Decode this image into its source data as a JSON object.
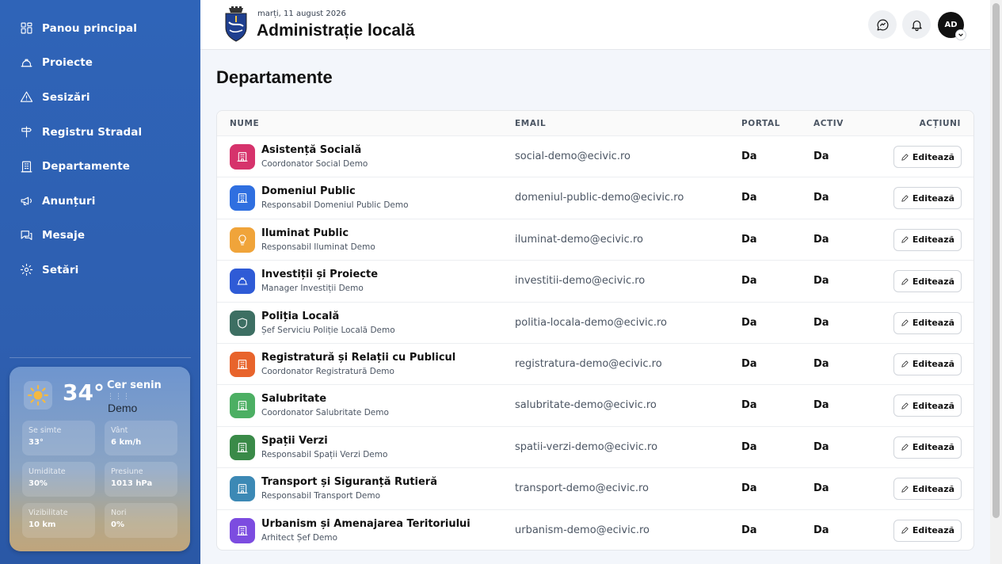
{
  "sidebar": {
    "items": [
      {
        "label": "Panou principal",
        "icon": "dashboard-icon"
      },
      {
        "label": "Proiecte",
        "icon": "helmet-icon"
      },
      {
        "label": "Sesizări",
        "icon": "warning-icon"
      },
      {
        "label": "Registru Stradal",
        "icon": "signpost-icon"
      },
      {
        "label": "Departamente",
        "icon": "building-icon"
      },
      {
        "label": "Anunțuri",
        "icon": "megaphone-icon"
      },
      {
        "label": "Mesaje",
        "icon": "chat-icon"
      },
      {
        "label": "Setări",
        "icon": "gear-icon"
      }
    ]
  },
  "weather": {
    "temp": "34°",
    "condition": "Cer senin",
    "dots": "⋮⋮⋮",
    "location": "Demo",
    "details": [
      {
        "label": "Se simte",
        "value": "33°"
      },
      {
        "label": "Vânt",
        "value": "6 km/h"
      },
      {
        "label": "Umiditate",
        "value": "30%"
      },
      {
        "label": "Presiune",
        "value": "1013 hPa"
      },
      {
        "label": "Vizibilitate",
        "value": "10 km"
      },
      {
        "label": "Nori",
        "value": "0%"
      }
    ]
  },
  "header": {
    "date": "marți, 11 august 2026",
    "title": "Administrație locală",
    "avatar_initials": "AD"
  },
  "page": {
    "title": "Departamente"
  },
  "table": {
    "columns": {
      "name": "NUME",
      "email": "EMAIL",
      "portal": "PORTAL",
      "active": "ACTIV",
      "actions": "ACȚIUNI"
    },
    "edit_label": "Editează",
    "rows": [
      {
        "name": "Asistență Socială",
        "sub": "Coordonator Social Demo",
        "email": "social-demo@ecivic.ro",
        "portal": "Da",
        "active": "Da",
        "color": "#d6336c",
        "icon": "building-icon"
      },
      {
        "name": "Domeniul Public",
        "sub": "Responsabil Domeniul Public Demo",
        "email": "domeniul-public-demo@ecivic.ro",
        "portal": "Da",
        "active": "Da",
        "color": "#2f6fe0",
        "icon": "building-icon"
      },
      {
        "name": "Iluminat Public",
        "sub": "Responsabil Iluminat Demo",
        "email": "iluminat-demo@ecivic.ro",
        "portal": "Da",
        "active": "Da",
        "color": "#f0a43a",
        "icon": "lightbulb-icon"
      },
      {
        "name": "Investiții și Proiecte",
        "sub": "Manager Investiții Demo",
        "email": "investitii-demo@ecivic.ro",
        "portal": "Da",
        "active": "Da",
        "color": "#2f5bd6",
        "icon": "helmet-icon"
      },
      {
        "name": "Poliția Locală",
        "sub": "Șef Serviciu Poliție Locală Demo",
        "email": "politia-locala-demo@ecivic.ro",
        "portal": "Da",
        "active": "Da",
        "color": "#3d6f63",
        "icon": "shield-icon"
      },
      {
        "name": "Registratură și Relații cu Publicul",
        "sub": "Coordonator Registratură Demo",
        "email": "registratura-demo@ecivic.ro",
        "portal": "Da",
        "active": "Da",
        "color": "#e8642c",
        "icon": "building-icon"
      },
      {
        "name": "Salubritate",
        "sub": "Coordonator Salubritate Demo",
        "email": "salubritate-demo@ecivic.ro",
        "portal": "Da",
        "active": "Da",
        "color": "#4caf63",
        "icon": "building-icon"
      },
      {
        "name": "Spații Verzi",
        "sub": "Responsabil Spații Verzi Demo",
        "email": "spatii-verzi-demo@ecivic.ro",
        "portal": "Da",
        "active": "Da",
        "color": "#3a8a48",
        "icon": "building-icon"
      },
      {
        "name": "Transport și Siguranță Rutieră",
        "sub": "Responsabil Transport Demo",
        "email": "transport-demo@ecivic.ro",
        "portal": "Da",
        "active": "Da",
        "color": "#3c89b5",
        "icon": "building-icon"
      },
      {
        "name": "Urbanism și Amenajarea Teritoriului",
        "sub": "Arhitect Șef Demo",
        "email": "urbanism-demo@ecivic.ro",
        "portal": "Da",
        "active": "Da",
        "color": "#7c4ce0",
        "icon": "building-icon"
      }
    ]
  }
}
